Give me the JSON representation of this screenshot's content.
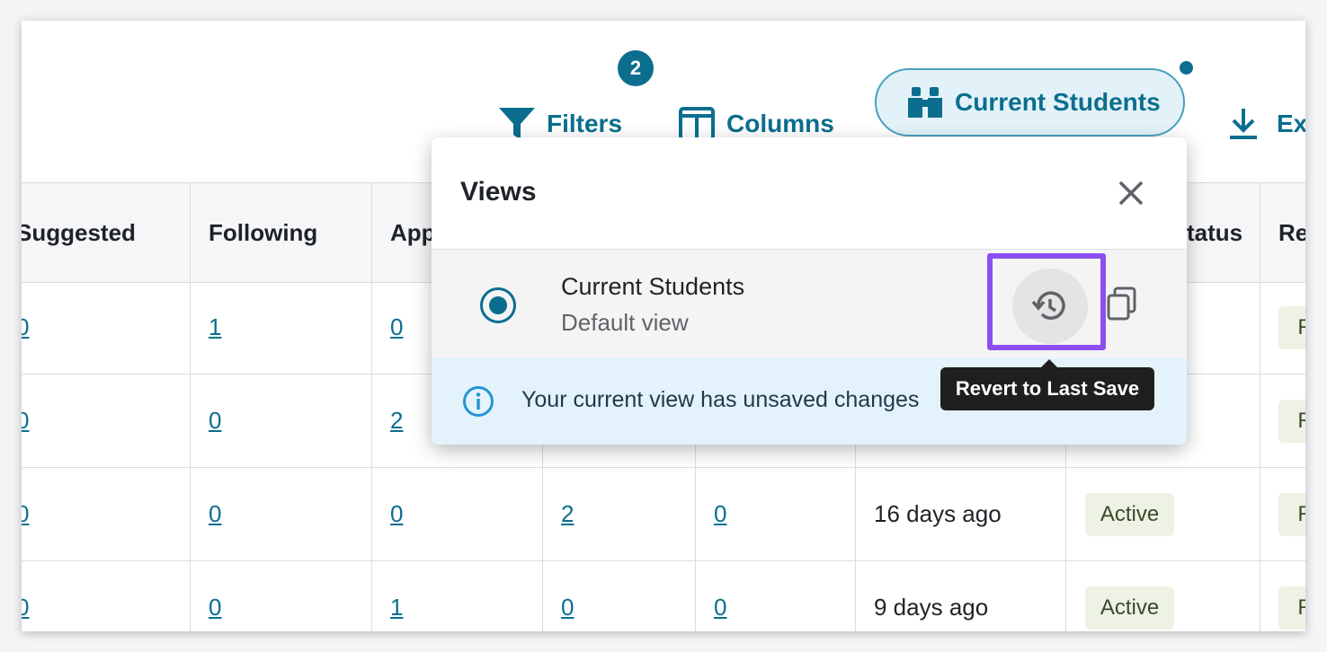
{
  "toolbar": {
    "filters_label": "Filters",
    "filters_badge": "2",
    "columns_label": "Columns",
    "view_label": "Current Students",
    "export_label": "Ex"
  },
  "table": {
    "headers": [
      "Suggested",
      "Following",
      "App",
      "tatus",
      "Re"
    ],
    "rows": [
      {
        "suggested": "0",
        "following": "1",
        "applied": "0",
        "c4": "",
        "c5": "",
        "last_active": "",
        "status": "",
        "r": "R"
      },
      {
        "suggested": "0",
        "following": "0",
        "applied": "2",
        "c4": "",
        "c5": "",
        "last_active": "",
        "status": "",
        "r": "R"
      },
      {
        "suggested": "0",
        "following": "0",
        "applied": "0",
        "c4": "2",
        "c5": "0",
        "last_active": "16 days ago",
        "status": "Active",
        "r": "R"
      },
      {
        "suggested": "0",
        "following": "0",
        "applied": "1",
        "c4": "0",
        "c5": "0",
        "last_active": "9 days ago",
        "status": "Active",
        "r": "R"
      }
    ]
  },
  "popover": {
    "title": "Views",
    "view_name": "Current Students",
    "view_subtitle": "Default view",
    "info_text": "Your current view has unsaved changes",
    "tooltip": "Revert to Last Save"
  },
  "colors": {
    "accent": "#0b6e8f",
    "highlight": "#8b4fef"
  },
  "icons": {
    "filters": "filter-icon",
    "columns": "columns-icon",
    "view": "binoculars-icon",
    "export": "download-icon",
    "close": "close-icon",
    "revert": "history-icon",
    "copy": "copy-icon",
    "info": "info-icon"
  }
}
